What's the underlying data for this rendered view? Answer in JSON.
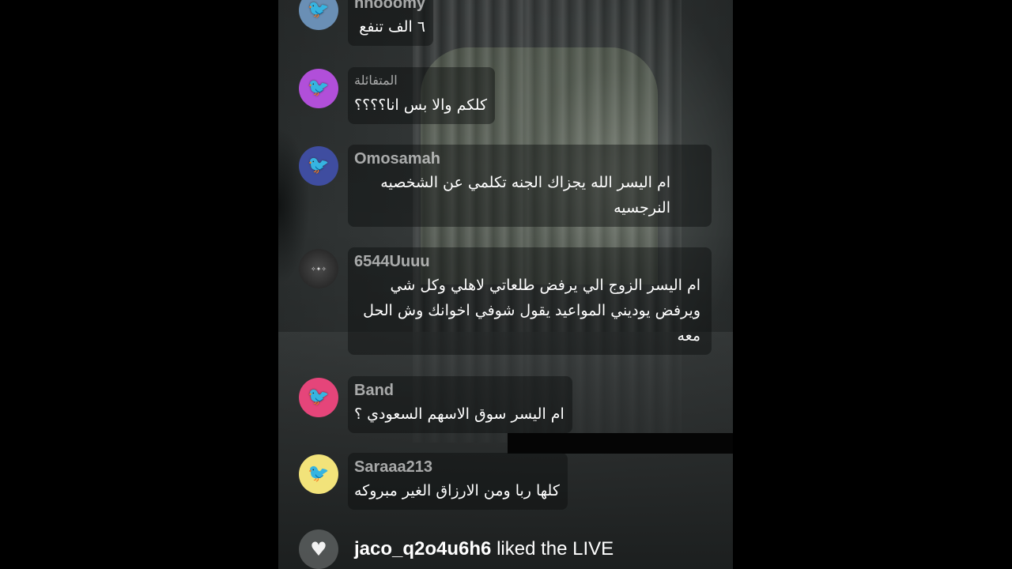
{
  "comments": [
    {
      "username": "hnooomy",
      "message": "٦ الف تنفع",
      "avatar_color": "#6a8fb5",
      "avatar_icon": "bird-icon"
    },
    {
      "username": "المتفائلة",
      "message": "كلكم والا بس انا؟؟؟؟",
      "avatar_color": "#b14fd9",
      "avatar_icon": "bird-icon"
    },
    {
      "username": "Omosamah",
      "message": "ام اليسر الله يجزاك الجنه تكلمي عن الشخصيه النرجسيه",
      "avatar_color": "#3f4da0",
      "avatar_icon": "bird-icon"
    },
    {
      "username": "6544Uuuu",
      "message": "ام اليسر الزوج الي يرفض طلعاتي لاهلي وكل شي ويرفض يوديني المواعيد يقول شوفي اخوانك وش الحل معه",
      "avatar_color": "#2a2a2a",
      "avatar_icon": "calligraphy-avatar"
    },
    {
      "username": "Band",
      "message": "ام اليسر سوق الاسهم السعودي ؟",
      "avatar_color": "#e5457a",
      "avatar_icon": "bird-icon"
    },
    {
      "username": "Saraaa213",
      "message": "كلها ربا ومن الارزاق الغير مبروكه",
      "avatar_color": "#f2e37a",
      "avatar_icon": "bird-icon"
    }
  ],
  "liked_event": {
    "username": "jaco_q2o4u6h6",
    "text": "liked the LIVE",
    "icon": "heart-icon"
  }
}
